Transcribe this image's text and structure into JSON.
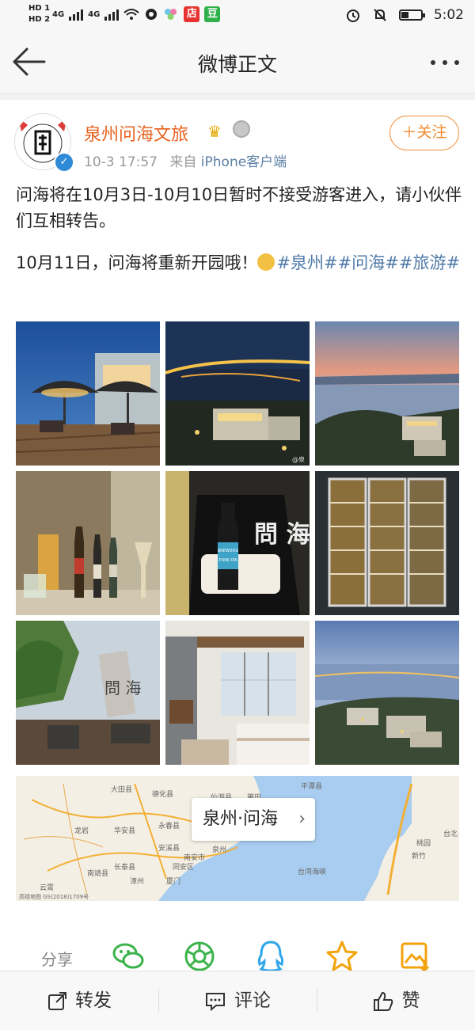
{
  "status_bar": {
    "sim1": "HD 1",
    "sim2": "HD 2",
    "net1": "4G",
    "net2": "4G",
    "app1_text": "店",
    "app2_text": "豆",
    "time": "5:02"
  },
  "nav": {
    "title": "微博正文"
  },
  "post": {
    "author": "泉州问海文旅",
    "time": "10-3 17:57",
    "source_prefix": "来自",
    "source_client": "iPhone客户端",
    "follow_label": "＋关注",
    "paragraph1": "问海将在10月3日-10月10日暂时不接受游客进入，请小伙伴们互相转告。",
    "paragraph2_text": "10月11日，问海将重新开园哦！",
    "topics": [
      "#泉州#",
      "#问海#",
      "#旅游#"
    ]
  },
  "photos": [
    {
      "name": "terrace-umbrellas-photo"
    },
    {
      "name": "night-coast-aerial-photo"
    },
    {
      "name": "sunset-sea-photo"
    },
    {
      "name": "beer-bottles-photo"
    },
    {
      "name": "brewdog-bottle-photo"
    },
    {
      "name": "beer-fridge-photo"
    },
    {
      "name": "garden-sculpture-photo"
    },
    {
      "name": "bedroom-view-photo"
    },
    {
      "name": "dusk-resort-aerial-photo"
    }
  ],
  "photo_labels": {
    "brewdog_text": "BREWDOG",
    "punk_text": "PUNK IPA",
    "brand_text": "問 海",
    "sculpture_text": "問 海"
  },
  "map": {
    "location_label": "泉州·问海",
    "places": [
      "莆田",
      "仙游县",
      "龙岩",
      "华安县",
      "泉州",
      "南安市",
      "安溪县",
      "厦门",
      "漳州",
      "台湾海峡",
      "新竹",
      "台北",
      "桃园",
      "平潭县",
      "永春县",
      "德化县",
      "大田县",
      "长泰县",
      "同安区",
      "南靖县",
      "云霄"
    ],
    "copyright": "高德地图 GS(2018)1709号"
  },
  "share": {
    "label": "分享"
  },
  "actions": {
    "repost": "转发",
    "comment": "评论",
    "like": "赞"
  },
  "colors": {
    "brand_orange": "#e8611e",
    "topic_blue": "#4f7aa8",
    "follow_orange": "#f08a32"
  }
}
